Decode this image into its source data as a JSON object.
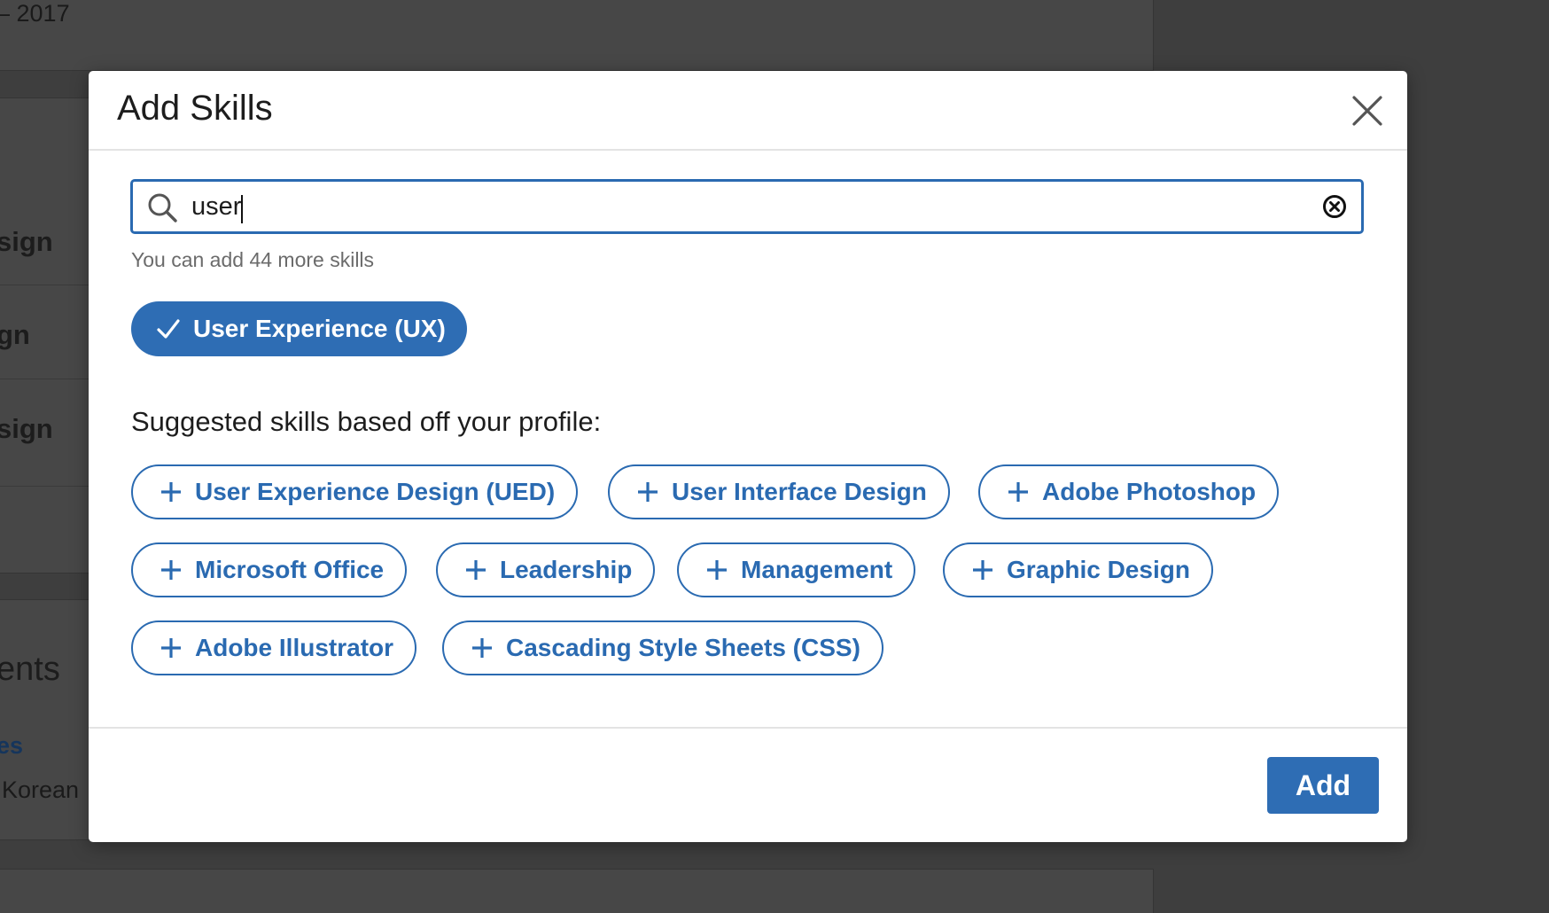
{
  "background": {
    "year_text": "– 2017",
    "rows": [
      "sign",
      "gn",
      "sign"
    ],
    "section_title": "ents",
    "link_text": "es",
    "language_text": "Korean"
  },
  "modal": {
    "title": "Add Skills",
    "close_icon": "close-icon",
    "search": {
      "value": "user",
      "placeholder": "",
      "icon": "search-icon",
      "clear_icon": "clear-circle-icon"
    },
    "hint": "You can add 44 more skills",
    "selected_skills": [
      {
        "label": "User Experience (UX)",
        "icon": "check-icon"
      }
    ],
    "suggested_heading": "Suggested skills based off your profile:",
    "suggested_skills": [
      {
        "label": "User Experience Design (UED)",
        "icon": "plus-icon"
      },
      {
        "label": "User Interface Design",
        "icon": "plus-icon"
      },
      {
        "label": "Adobe Photoshop",
        "icon": "plus-icon"
      },
      {
        "label": "Microsoft Office",
        "icon": "plus-icon"
      },
      {
        "label": "Leadership",
        "icon": "plus-icon"
      },
      {
        "label": "Management",
        "icon": "plus-icon"
      },
      {
        "label": "Graphic Design",
        "icon": "plus-icon"
      },
      {
        "label": "Adobe Illustrator",
        "icon": "plus-icon"
      },
      {
        "label": "Cascading Style Sheets (CSS)",
        "icon": "plus-icon"
      }
    ],
    "add_button": "Add"
  },
  "colors": {
    "accent": "#2e6db4",
    "overlay_background": "#3e3e3e",
    "modal_background": "#ffffff"
  }
}
